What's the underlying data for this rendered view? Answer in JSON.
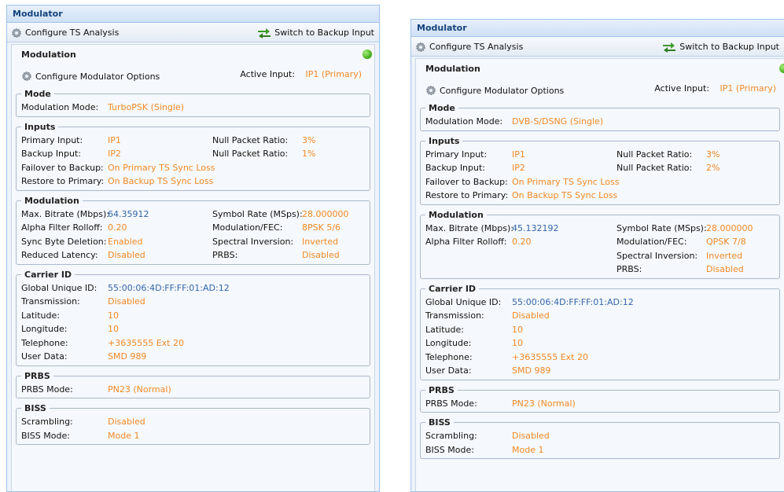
{
  "colors": {
    "value_orange": "#f08a24",
    "value_blue": "#3366aa",
    "title_blue": "#14437c",
    "status_green": "#3aa60f"
  },
  "panels": [
    {
      "title": "Modulator",
      "toolbar": {
        "configure_ts": "Configure TS Analysis",
        "switch_backup": "Switch to Backup Input"
      },
      "header": "Modulation",
      "configure_modulator": "Configure Modulator Options",
      "active_input_label": "Active Input:",
      "active_input_value": "IP1 (Primary)",
      "mode": {
        "legend": "Mode",
        "label": "Modulation Mode:",
        "value": "TurboPSK (Single)"
      },
      "inputs": {
        "legend": "Inputs",
        "primary_label": "Primary Input:",
        "primary_value": "IP1",
        "primary_npr_label": "Null Packet Ratio:",
        "primary_npr_value": "3%",
        "backup_label": "Backup Input:",
        "backup_value": "IP2",
        "backup_npr_label": "Null Packet Ratio:",
        "backup_npr_value": "1%",
        "failover_label": "Failover to Backup:",
        "failover_value": "On Primary TS Sync Loss",
        "restore_label": "Restore to Primary:",
        "restore_value": "On Backup TS Sync Loss"
      },
      "modulation": {
        "legend": "Modulation",
        "bitrate_label": "Max. Bitrate (Mbps):",
        "bitrate_value": "64.35912",
        "symbol_label": "Symbol Rate (MSps):",
        "symbol_value": "28.000000",
        "alpha_label": "Alpha Filter Rolloff:",
        "alpha_value": "0.20",
        "modfec_label": "Modulation/FEC:",
        "modfec_value": "8PSK 5/6",
        "sync_label": "Sync Byte Deletion:",
        "sync_value": "Enabled",
        "spectral_label": "Spectral Inversion:",
        "spectral_value": "Inverted",
        "latency_label": "Reduced Latency:",
        "latency_value": "Disabled",
        "prbs_label": "PRBS:",
        "prbs_value": "Disabled"
      },
      "carrier": {
        "legend": "Carrier ID",
        "guid_label": "Global Unique ID:",
        "guid_value": "55:00:06:4D:FF:FF:01:AD:12",
        "tx_label": "Transmission:",
        "tx_value": "Disabled",
        "lat_label": "Latitude:",
        "lat_value": "10",
        "lon_label": "Longitude:",
        "lon_value": "10",
        "tel_label": "Telephone:",
        "tel_value": "+3635555 Ext 20",
        "user_label": "User Data:",
        "user_value": "SMD 989"
      },
      "prbs": {
        "legend": "PRBS",
        "label": "PRBS Mode:",
        "value": "PN23 (Normal)"
      },
      "biss": {
        "legend": "BISS",
        "scr_label": "Scrambling:",
        "scr_value": "Disabled",
        "mode_label": "BISS Mode:",
        "mode_value": "Mode 1"
      }
    },
    {
      "title": "Modulator",
      "toolbar": {
        "configure_ts": "Configure TS Analysis",
        "switch_backup": "Switch to Backup Input"
      },
      "header": "Modulation",
      "configure_modulator": "Configure Modulator Options",
      "active_input_label": "Active Input:",
      "active_input_value": "IP1 (Primary)",
      "mode": {
        "legend": "Mode",
        "label": "Modulation Mode:",
        "value": "DVB-S/DSNG (Single)"
      },
      "inputs": {
        "legend": "Inputs",
        "primary_label": "Primary Input:",
        "primary_value": "IP1",
        "primary_npr_label": "Null Packet Ratio:",
        "primary_npr_value": "3%",
        "backup_label": "Backup Input:",
        "backup_value": "IP2",
        "backup_npr_label": "Null Packet Ratio:",
        "backup_npr_value": "2%",
        "failover_label": "Failover to Backup:",
        "failover_value": "On Primary TS Sync Loss",
        "restore_label": "Restore to Primary:",
        "restore_value": "On Backup TS Sync Loss"
      },
      "modulation": {
        "legend": "Modulation",
        "bitrate_label": "Max. Bitrate (Mbps):",
        "bitrate_value": "45.132192",
        "symbol_label": "Symbol Rate (MSps):",
        "symbol_value": "28.000000",
        "alpha_label": "Alpha Filter Rolloff:",
        "alpha_value": "0.20",
        "modfec_label": "Modulation/FEC:",
        "modfec_value": "QPSK 7/8",
        "spectral_label": "Spectral Inversion:",
        "spectral_value": "Inverted",
        "prbs_label": "PRBS:",
        "prbs_value": "Disabled"
      },
      "carrier": {
        "legend": "Carrier ID",
        "guid_label": "Global Unique ID:",
        "guid_value": "55:00:06:4D:FF:FF:01:AD:12",
        "tx_label": "Transmission:",
        "tx_value": "Disabled",
        "lat_label": "Latitude:",
        "lat_value": "10",
        "lon_label": "Longitude:",
        "lon_value": "10",
        "tel_label": "Telephone:",
        "tel_value": "+3635555 Ext 20",
        "user_label": "User Data:",
        "user_value": "SMD 989"
      },
      "prbs": {
        "legend": "PRBS",
        "label": "PRBS Mode:",
        "value": "PN23 (Normal)"
      },
      "biss": {
        "legend": "BISS",
        "scr_label": "Scrambling:",
        "scr_value": "Disabled",
        "mode_label": "BISS Mode:",
        "mode_value": "Mode 1"
      }
    }
  ]
}
